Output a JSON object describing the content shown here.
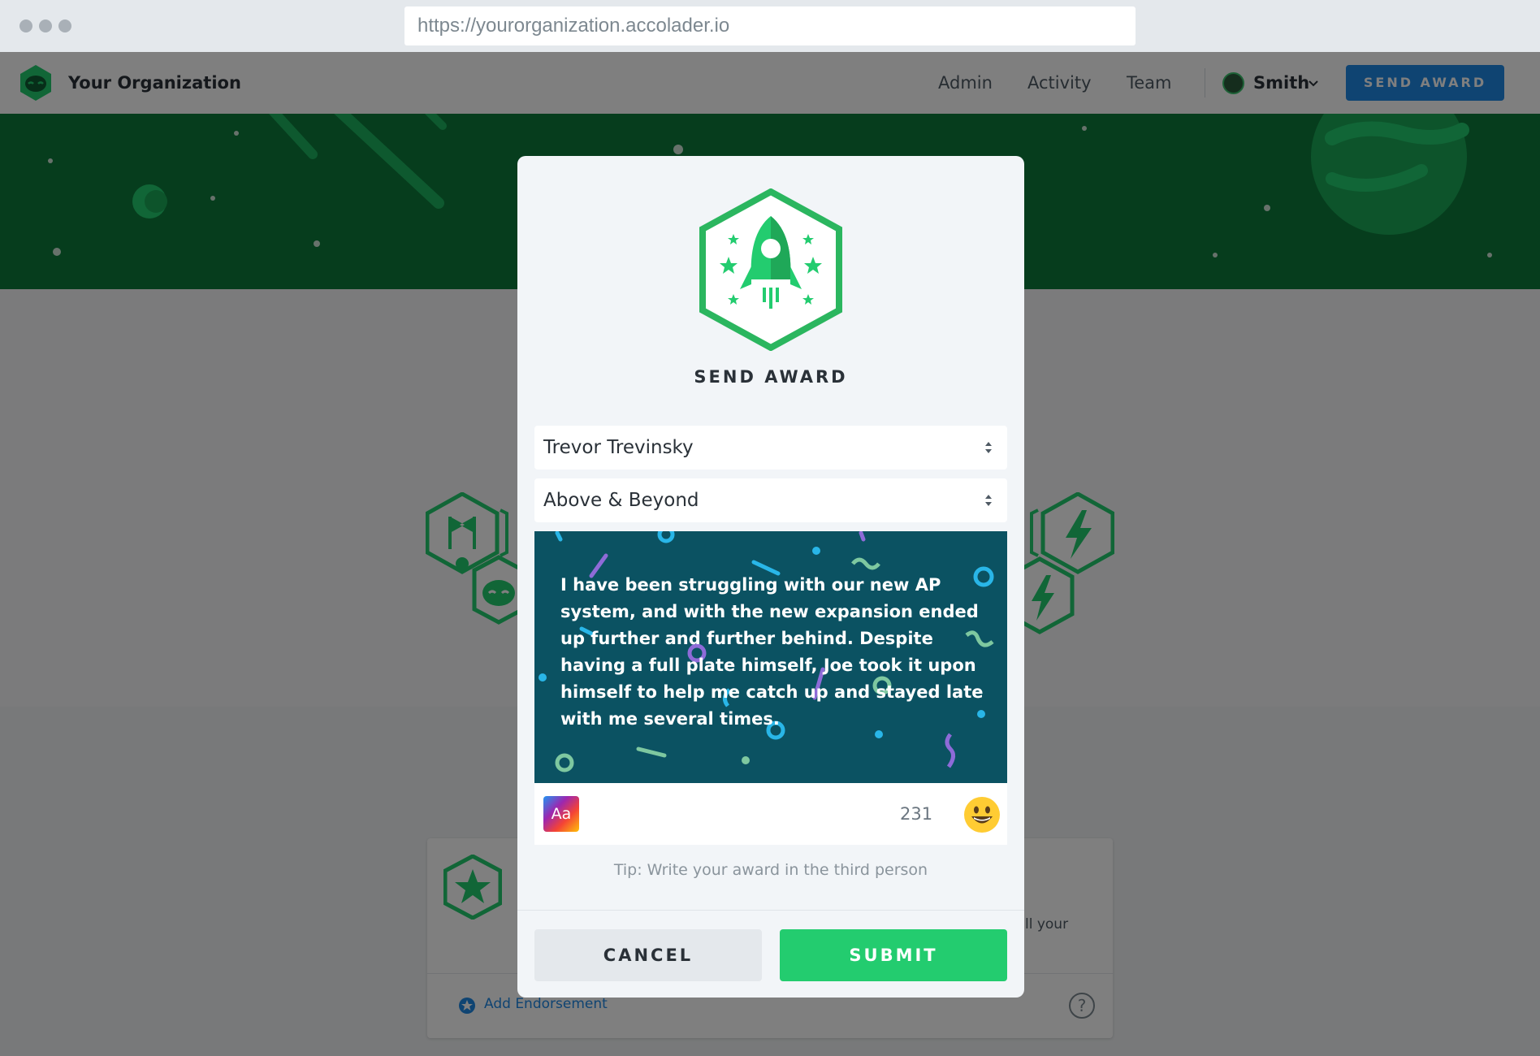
{
  "browser": {
    "url": "https://yourorganization.accolader.io"
  },
  "header": {
    "org_name": "Your Organization",
    "nav": [
      "Admin",
      "Activity",
      "Team"
    ],
    "user_name": "Smith",
    "send_award_label": "SEND AWARD"
  },
  "background_card": {
    "text_tail": "ll your",
    "add_endorsement_label": "Add Endorsement",
    "help_label": "?"
  },
  "modal": {
    "title": "SEND AWARD",
    "recipient_value": "Trevor Trevinsky",
    "award_type_value": "Above & Beyond",
    "message": "I have been struggling with our new AP system, and with the new expansion ended up further and further behind. Despite having a full plate himself, Joe took it upon himself to help me catch up and stayed late with me several times.",
    "font_button_label": "Aa",
    "char_count": "231",
    "emoji_icon": "smiley-face-icon",
    "tip": "Tip: Write your award in the third person",
    "cancel_label": "CANCEL",
    "submit_label": "SUBMIT"
  },
  "colors": {
    "brand_green": "#23cc6f",
    "primary_blue": "#1e88e5",
    "hero_green": "#0c7a3a",
    "message_bg": "#0b5262"
  }
}
